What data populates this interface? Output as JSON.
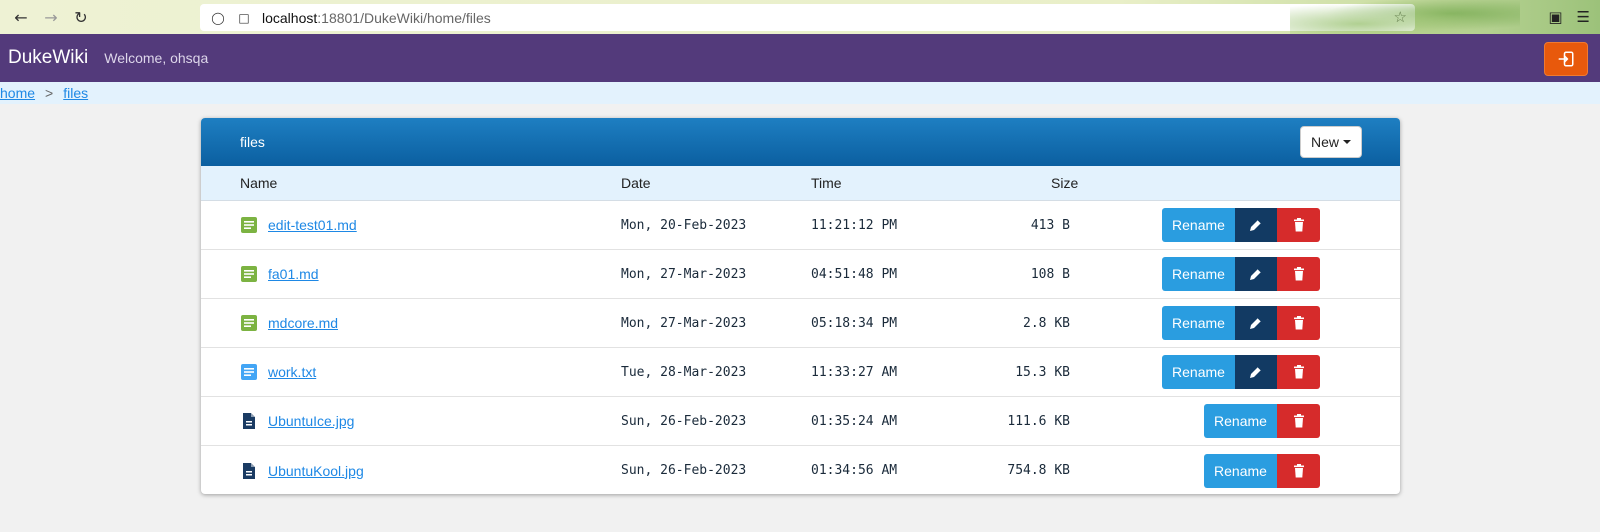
{
  "browser": {
    "url_host": "localhost",
    "url_path": ":18801/DukeWiki/home/files"
  },
  "app": {
    "brand": "DukeWiki",
    "welcome": "Welcome, ohsqa",
    "logout_icon": "logout-icon",
    "accent_color": "#533a7b",
    "logout_color": "#e8590c"
  },
  "breadcrumb": {
    "items": [
      "home",
      "files"
    ],
    "separator": ">"
  },
  "card": {
    "title": "files",
    "new_label": "New",
    "columns": {
      "name": "Name",
      "date": "Date",
      "time": "Time",
      "size": "Size"
    },
    "rename_label": "Rename",
    "files": [
      {
        "name": "edit-test01.md",
        "date": "Mon, 20-Feb-2023",
        "time": "11:21:12 PM",
        "size": "413 B",
        "icon": "markdown-file-icon",
        "icon_color": "#7cb342",
        "editable": true
      },
      {
        "name": "fa01.md",
        "date": "Mon, 27-Mar-2023",
        "time": "04:51:48 PM",
        "size": "108 B",
        "icon": "markdown-file-icon",
        "icon_color": "#7cb342",
        "editable": true
      },
      {
        "name": "mdcore.md",
        "date": "Mon, 27-Mar-2023",
        "time": "05:18:34 PM",
        "size": "2.8 KB",
        "icon": "markdown-file-icon",
        "icon_color": "#7cb342",
        "editable": true
      },
      {
        "name": "work.txt",
        "date": "Tue, 28-Mar-2023",
        "time": "11:33:27 AM",
        "size": "15.3 KB",
        "icon": "text-file-icon",
        "icon_color": "#42a5f5",
        "editable": true
      },
      {
        "name": "UbuntuIce.jpg",
        "date": "Sun, 26-Feb-2023",
        "time": "01:35:24 AM",
        "size": "111.6 KB",
        "icon": "document-file-icon",
        "icon_color": "#1a3b63",
        "editable": false
      },
      {
        "name": "UbuntuKool.jpg",
        "date": "Sun, 26-Feb-2023",
        "time": "01:34:56 AM",
        "size": "754.8 KB",
        "icon": "document-file-icon",
        "icon_color": "#1a3b63",
        "editable": false
      }
    ]
  }
}
